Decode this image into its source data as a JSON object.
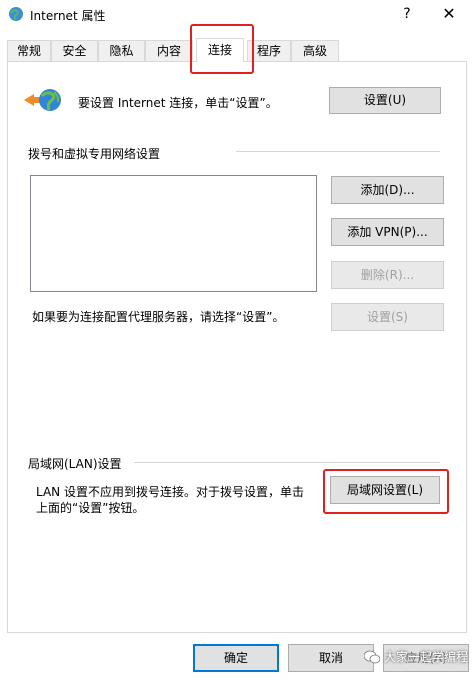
{
  "window": {
    "title": "Internet 属性",
    "help_glyph": "?",
    "close_glyph": "✕"
  },
  "tabs": [
    {
      "label": "常规"
    },
    {
      "label": "安全"
    },
    {
      "label": "隐私"
    },
    {
      "label": "内容"
    },
    {
      "label": "连接",
      "active": true
    },
    {
      "label": "程序"
    },
    {
      "label": "高级"
    }
  ],
  "setup": {
    "text": "要设置 Internet 连接，单击“设置”。",
    "button": "设置(U)"
  },
  "dialup": {
    "heading": "拨号和虚拟专用网络设置",
    "add_button": "添加(D)...",
    "add_vpn_button": "添加 VPN(P)...",
    "remove_button": "删除(R)...",
    "proxy_text": "如果要为连接配置代理服务器，请选择“设置”。",
    "settings_button": "设置(S)"
  },
  "lan": {
    "heading": "局域网(LAN)设置",
    "text_line1": "LAN 设置不应用到拨号连接。对于拨号设置，单击",
    "text_line2": "上面的“设置”按钮。",
    "button": "局域网设置(L)"
  },
  "footer": {
    "ok": "确定",
    "cancel": "取消",
    "apply": "应用(A)"
  },
  "watermark": "大家一起学编程",
  "colors": {
    "highlight_red": "#e02020",
    "default_button_border": "#0078d7"
  }
}
